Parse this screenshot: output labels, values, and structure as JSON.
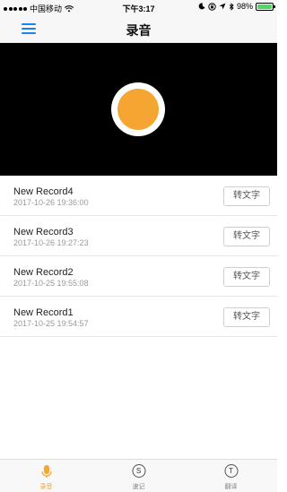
{
  "status_bar": {
    "carrier": "中国移动",
    "time": "下午3:17",
    "battery": "98%"
  },
  "nav": {
    "title": "录音"
  },
  "records": [
    {
      "name": "New Record4",
      "date": "2017-10-26 19:36:00",
      "action": "转文字"
    },
    {
      "name": "New Record3",
      "date": "2017-10-26 19:27:23",
      "action": "转文字"
    },
    {
      "name": "New Record2",
      "date": "2017-10-25 19:55:08",
      "action": "转文字"
    },
    {
      "name": "New Record1",
      "date": "2017-10-25 19:54:57",
      "action": "转文字"
    }
  ],
  "tabs": [
    {
      "label": "录音",
      "icon": "microphone-icon",
      "active": true
    },
    {
      "label": "速记",
      "icon": "shorthand-s-icon",
      "glyph": "S",
      "active": false
    },
    {
      "label": "翻译",
      "icon": "translate-t-icon",
      "glyph": "T",
      "active": false
    }
  ],
  "colors": {
    "accent": "#f5a532",
    "nav_icon": "#1d7ff0",
    "record_bg": "#000000"
  }
}
